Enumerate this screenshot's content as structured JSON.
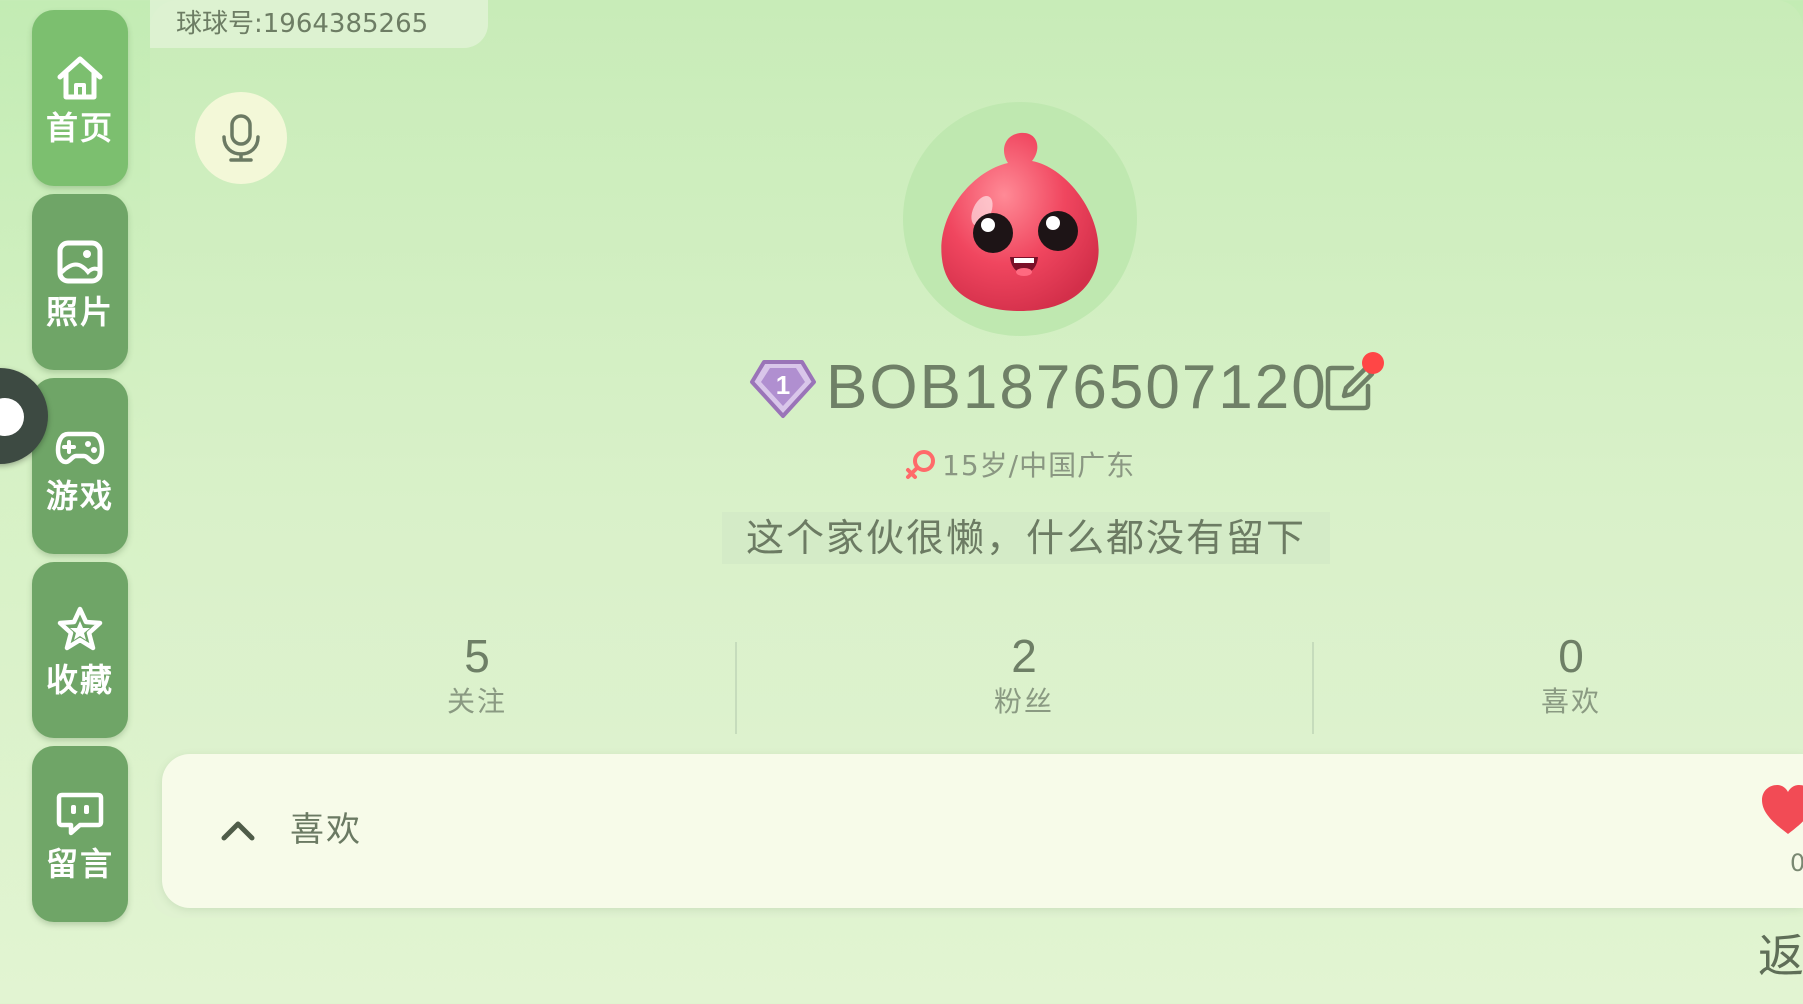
{
  "sidebar": {
    "items": [
      {
        "label": "首页",
        "icon": "home-icon"
      },
      {
        "label": "照片",
        "icon": "photo-icon"
      },
      {
        "label": "游戏",
        "icon": "gamepad-icon"
      },
      {
        "label": "收藏",
        "icon": "star-icon"
      },
      {
        "label": "留言",
        "icon": "message-icon"
      }
    ]
  },
  "profile": {
    "id_text": "球球号:1964385265",
    "level": "1",
    "username": "BOB1876507120",
    "meta": "15岁/中国广东",
    "bio": "这个家伙很懒，什么都没有留下"
  },
  "stats": [
    {
      "value": "5",
      "label": "关注"
    },
    {
      "value": "2",
      "label": "粉丝"
    },
    {
      "value": "0",
      "label": "喜欢"
    }
  ],
  "likes_section": {
    "title": "喜欢",
    "count_hint": "0"
  },
  "back_label": "返",
  "colors": {
    "background": "#c3ecb4",
    "sidebar_button": "#6fa567",
    "notification_dot": "#ff4646",
    "avatar": "#f0465f",
    "level_badge": "#9a74b8"
  }
}
